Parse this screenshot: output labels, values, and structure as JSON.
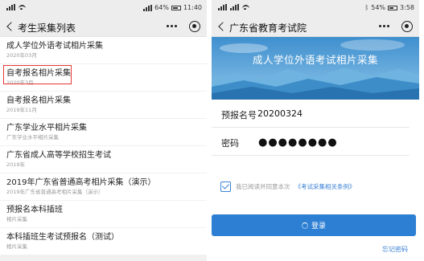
{
  "left_phone": {
    "status": {
      "battery": "64%",
      "time": "11:40"
    },
    "nav_title": "考生采集列表",
    "items": [
      {
        "title": "成人学位外语考试相片采集",
        "sub": "2020年03月"
      },
      {
        "title": "自考报名相片采集",
        "sub": "2020年3月"
      },
      {
        "title": "自考报名相片采集",
        "sub": "2019年11月"
      },
      {
        "title": "广东学业水平相片采集",
        "sub": "广东学业水平相片采集"
      },
      {
        "title": "广东省成人高等学校招生考试",
        "sub": "2019年"
      },
      {
        "title": "2019年广东省普通高考相片采集（演示）",
        "sub": "2019年广东省普通高考相片采集（演示）"
      },
      {
        "title": "预报名本科插班",
        "sub": "相片采集"
      },
      {
        "title": "本科插班生考试预报名（测试）",
        "sub": "相片采集"
      }
    ]
  },
  "right_phone": {
    "status": {
      "battery": "54%",
      "time": "3:58"
    },
    "nav_title": "广东省教育考试院",
    "banner_title": "成人学位外语考试相片采集",
    "form": {
      "number_label": "预报名号",
      "number_value": "20200324",
      "password_label": "密码",
      "password_value": "●●●●●●●●"
    },
    "agree_text": "我已阅读并同意本次",
    "agree_link": "《考试采集相关条例》",
    "login_label": "登录",
    "forgot_label": "忘记密码"
  },
  "colors": {
    "accent": "#2d7fd3",
    "highlight": "#e53935",
    "banner_sky": "#5aa3d6"
  },
  "icons": [
    "signal-icon",
    "wifi-icon",
    "bluetooth-icon",
    "battery-icon",
    "back-arrow-icon",
    "more-icon",
    "target-icon",
    "check-icon",
    "spinner-icon"
  ]
}
